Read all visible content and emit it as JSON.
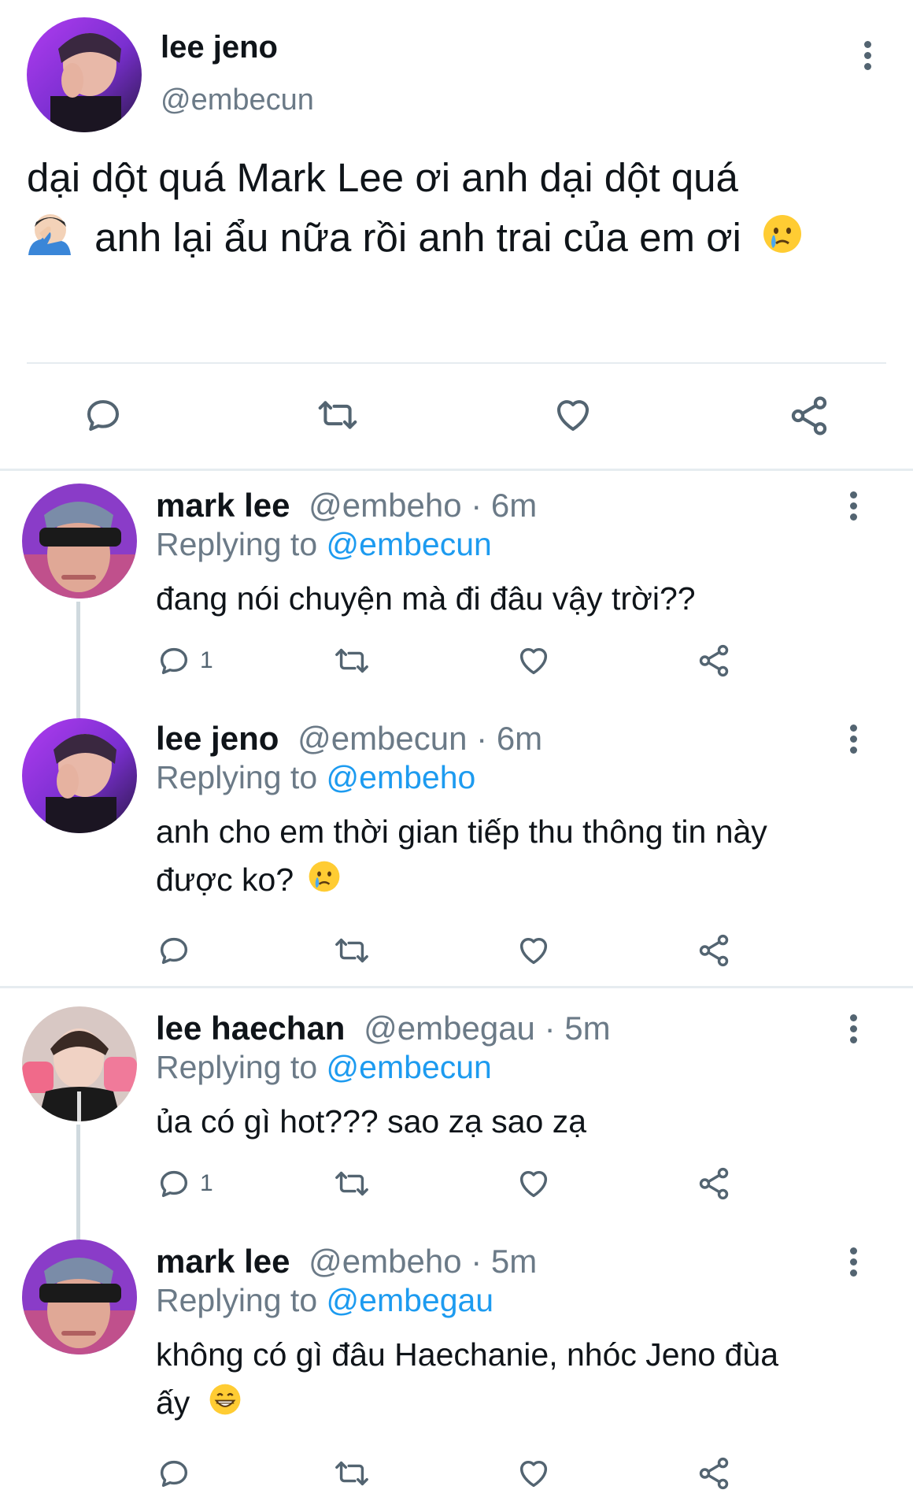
{
  "main_tweet": {
    "name": "lee jeno",
    "handle": "@embecun",
    "text_line1": "dại dột quá Mark Lee ơi anh dại dột quá",
    "text_line2": "anh lại ẩu nữa rồi anh trai của em ơi",
    "emoji_start": "facepalm-emoji",
    "emoji_end": "sad-tear-emoji"
  },
  "replies": [
    {
      "name": "mark lee",
      "meta": "@embeho · 6m",
      "replying_prefix": "Replying to ",
      "replying_to": "@embecun",
      "text": "đang nói chuyện mà đi đâu vậy trời??",
      "reply_count": "1"
    },
    {
      "name": "lee jeno",
      "meta": "@embecun · 6m",
      "replying_prefix": "Replying to ",
      "replying_to": "@embeho",
      "text_line1": "anh cho em thời gian tiếp thu thông tin này",
      "text_line2": "được ko?",
      "emoji": "sad-tear-emoji"
    },
    {
      "name": "lee haechan",
      "meta": "@embegau · 5m",
      "replying_prefix": "Replying to ",
      "replying_to": "@embecun",
      "text": "ủa có gì hot??? sao zạ sao zạ",
      "reply_count": "1"
    },
    {
      "name": "mark lee",
      "meta": "@embeho · 5m",
      "replying_prefix": "Replying to ",
      "replying_to": "@embegau",
      "text_line1": "không có gì đâu Haechanie, nhóc Jeno đùa",
      "text_line2": "ấy",
      "emoji": "grinning-emoji"
    }
  ],
  "colors": {
    "link": "#1d9bf0",
    "secondary_text": "#6b7a87",
    "icon": "#536471",
    "divider": "#e6ecf0"
  },
  "icons": [
    "reply-icon",
    "retweet-icon",
    "like-icon",
    "share-icon",
    "more-icon"
  ]
}
